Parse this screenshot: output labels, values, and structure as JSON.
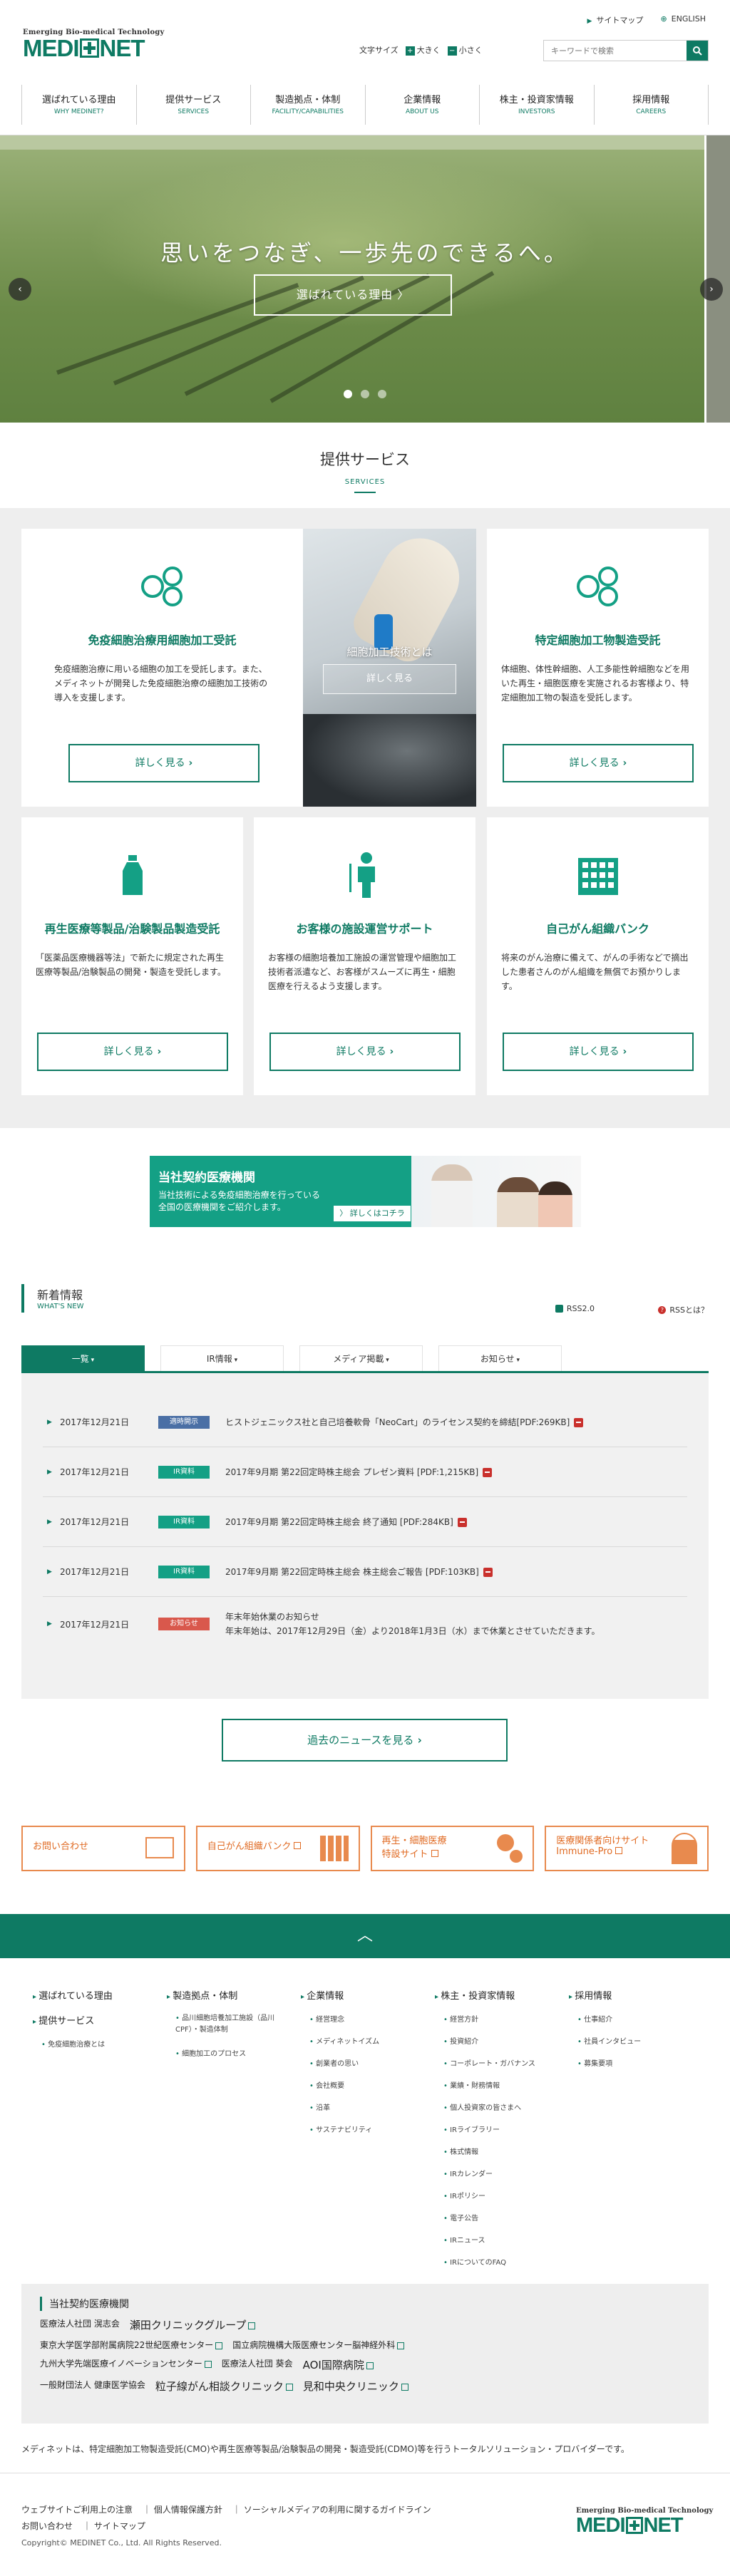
{
  "header": {
    "logo_tag": "Emerging Bio-medical Technology",
    "logo_left": "MEDI",
    "logo_right": "NET",
    "sitemap": "サイトマップ",
    "english": "ENGLISH",
    "fontsize_label": "文字サイズ",
    "fontsize_large": "大きく",
    "fontsize_small": "小さく",
    "search_placeholder": "キーワードで検索",
    "nav": [
      {
        "jp": "選ばれている理由",
        "en": "WHY MEDINET?"
      },
      {
        "jp": "提供サービス",
        "en": "SERVICES"
      },
      {
        "jp": "製造拠点・体制",
        "en": "FACILITY/CAPABILITIES"
      },
      {
        "jp": "企業情報",
        "en": "ABOUT US"
      },
      {
        "jp": "株主・投資家情報",
        "en": "INVESTORS"
      },
      {
        "jp": "採用情報",
        "en": "CAREERS"
      }
    ]
  },
  "hero": {
    "headline": "思いをつなぎ、一歩先のできるへ。",
    "cta": "選ばれている理由 〉"
  },
  "services": {
    "title_jp": "提供サービス",
    "title_en": "SERVICES",
    "more": "詳しく見る",
    "cards": [
      {
        "title": "免疫細胞治療用細胞加工受託",
        "desc": "免疫細胞治療に用いる細胞の加工を受託します。また、メディネットが開発した免疫細胞治療の細胞加工技術の導入を支援します。",
        "icon": "cells-icon"
      },
      {
        "title": "特定細胞加工物製造受託",
        "desc": "体細胞、体性幹細胞、人工多能性幹細胞などを用いた再生・細胞医療を実施されるお客様より、特定細胞加工物の製造を受託します。",
        "icon": "cells-icon"
      },
      {
        "title": "再生医療等製品/治験製品製造受託",
        "desc": "「医薬品医療機器等法」で新たに規定された再生医療等製品/治験製品の開発・製造を受託します。",
        "icon": "bottle-icon"
      },
      {
        "title": "お客様の施設運営サポート",
        "desc": "お客様の細胞培養加工施設の運営管理や細胞加工技術者派遣など、お客様がスムーズに再生・細胞医療を行えるよう支援します。",
        "icon": "staff-icon"
      },
      {
        "title": "自己がん組織バンク",
        "desc": "将来のがん治療に備えて、がんの手術などで摘出した患者さんのがん組織を無償でお預かりします。",
        "icon": "building-icon"
      }
    ],
    "photo_card": {
      "title": "細胞加工技術とは",
      "more": "詳しく見る"
    }
  },
  "banner": {
    "title": "当社契約医療機関",
    "sub1": "当社技術による免疫細胞治療を行っている",
    "sub2": "全国の医療機関をご紹介します。",
    "button": "〉 詳しくはコチラ"
  },
  "news": {
    "title_jp": "新着情報",
    "title_en": "WHAT'S NEW",
    "rss": "RSS2.0",
    "rss_help": "RSSとは？",
    "tabs": [
      "一覧",
      "IR情報",
      "メディア掲載",
      "お知らせ"
    ],
    "items": [
      {
        "date": "2017年12月21日",
        "tag": "適時開示",
        "tag_color": "#4a6fa5",
        "text": "ヒストジェニックス社と自己培養軟骨「NeoCart」のライセンス契約を締結[PDF:269KB]",
        "pdf": true
      },
      {
        "date": "2017年12月21日",
        "tag": "IR資料",
        "tag_color": "#14a085",
        "text": "2017年9月期 第22回定時株主総会 プレゼン資料 [PDF:1,215KB]",
        "pdf": true
      },
      {
        "date": "2017年12月21日",
        "tag": "IR資料",
        "tag_color": "#14a085",
        "text": "2017年9月期 第22回定時株主総会 終了通知 [PDF:284KB]",
        "pdf": true
      },
      {
        "date": "2017年12月21日",
        "tag": "IR資料",
        "tag_color": "#14a085",
        "text": "2017年9月期 第22回定時株主総会 株主総会ご報告 [PDF:103KB]",
        "pdf": true
      },
      {
        "date": "2017年12月21日",
        "tag": "お知らせ",
        "tag_color": "#d9584c",
        "text": "年末年始休業のお知らせ",
        "text2": "年末年始は、2017年12月29日（金）より2018年1月3日（水）まで休業とさせていただきます。",
        "pdf": false
      }
    ],
    "past": "過去のニュースを見る"
  },
  "link_banners": [
    {
      "label": "お問い合わせ",
      "icon": "mail-icon"
    },
    {
      "label": "自己がん組織バンク",
      "icon": "building-icon"
    },
    {
      "label": "再生・細胞医療",
      "label2": "特設サイト",
      "icon": "cells-icon"
    },
    {
      "label": "医療関係者向けサイト",
      "label2": "Immune-Pro",
      "icon": "doctor-icon"
    }
  ],
  "footer": {
    "cols": [
      {
        "items": [
          {
            "h": "選ばれている理由"
          },
          {
            "h": "提供サービス",
            "subs": [
              "免疫細胞治療とは"
            ]
          }
        ]
      },
      {
        "items": [
          {
            "h": "製造拠点・体制",
            "subs": [
              "品川細胞培養加工施設（品川CPF）・製造体制",
              "細胞加工のプロセス"
            ]
          }
        ]
      },
      {
        "items": [
          {
            "h": "企業情報",
            "subs": [
              "経営理念",
              "メディネットイズム",
              "創業者の思い",
              "会社概要",
              "沿革",
              "サステナビリティ"
            ]
          }
        ]
      },
      {
        "items": [
          {
            "h": "株主・投資家情報",
            "subs": [
              "経営方針",
              "投資紹介",
              "コーポレート・ガバナンス",
              "業績・財務情報",
              "個人投資家の皆さまへ",
              "IRライブラリー",
              "株式情報",
              "IRカレンダー",
              "IRポリシー",
              "電子公告",
              "IRニュース",
              "IRについてのFAQ"
            ]
          }
        ]
      },
      {
        "items": [
          {
            "h": "採用情報",
            "subs": [
              "仕事紹介",
              "社員インタビュー",
              "募集要項"
            ]
          }
        ]
      }
    ],
    "clinic_title": "当社契約医療機関",
    "clinic_rows": [
      [
        "医療法人社団 滉志会",
        "瀬田クリニックグループ"
      ],
      [
        "東京大学医学部附属病院22世紀医療センター",
        "国立病院機構大阪医療センター脳神経外科"
      ],
      [
        "九州大学先端医療イノベーションセンター",
        "医療法人社団 葵会",
        "AOI国際病院"
      ],
      [
        "一般財団法人 健康医学協会",
        "粒子線がん相談クリニック",
        "見和中央クリニック"
      ]
    ],
    "description": "メディネットは、特定細胞加工物製造受託(CMO)や再生医療等製品/治験製品の開発・製造受託(CDMO)等を行うトータルソリューション・プロバイダーです。",
    "links_row1": [
      "ウェブサイトご利用上の注意",
      "個人情報保護方針",
      "ソーシャルメディアの利用に関するガイドライン"
    ],
    "links_row2": [
      "お問い合わせ",
      "サイトマップ"
    ],
    "copyright": "Copyright© MEDINET Co., Ltd. All Rights Reserved."
  },
  "colors": {
    "brand": "#0e7a63",
    "accent_orange": "#e88a4e"
  }
}
